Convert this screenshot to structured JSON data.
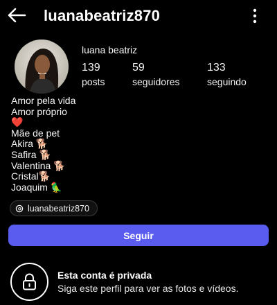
{
  "header": {
    "username": "luanabeatriz870",
    "back_icon": "arrow-left-icon",
    "more_icon": "more-vertical-icon"
  },
  "profile": {
    "display_name": "luana beatriz",
    "avatar_icon": "avatar",
    "stats": {
      "posts_count": "139",
      "posts_label": "posts",
      "followers_count": "59",
      "followers_label": "seguidores",
      "following_count": "133",
      "following_label": "seguindo"
    }
  },
  "bio": {
    "line1": "Amor pela vida",
    "line2": "Amor próprio",
    "line3": "❤️",
    "line4": "Mãe de pet",
    "line5": "Akira 🐕",
    "line6": "Safira 🐕",
    "line7": "Valentina 🐕",
    "line8": "Cristal🐕",
    "line9": "Joaquim 🦜"
  },
  "threads": {
    "icon": "threads-icon",
    "handle": "luanabeatriz870"
  },
  "actions": {
    "follow_label": "Seguir"
  },
  "private_notice": {
    "icon": "lock-icon",
    "title": "Esta conta é privada",
    "subtitle": "Siga este perfil para ver as fotos e vídeos."
  },
  "colors": {
    "background": "#000000",
    "accent": "#5a5cf0",
    "text": "#f5f5f5",
    "heart": "#e0242d"
  }
}
